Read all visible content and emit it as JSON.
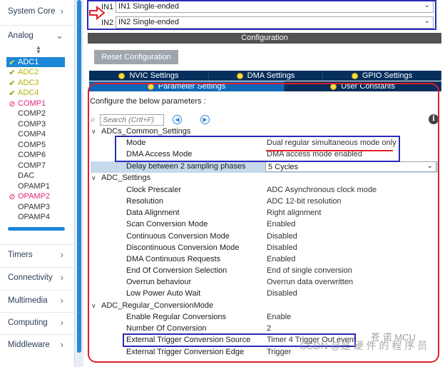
{
  "sidebar": {
    "categories": {
      "system_core": "System Core",
      "analog": "Analog",
      "timers": "Timers",
      "connectivity": "Connectivity",
      "multimedia": "Multimedia",
      "computing": "Computing",
      "middleware": "Middleware"
    },
    "peripherals": [
      {
        "label": "ADC1",
        "status": "selected"
      },
      {
        "label": "ADC2",
        "status": "ok"
      },
      {
        "label": "ADC3",
        "status": "ok"
      },
      {
        "label": "ADC4",
        "status": "ok"
      },
      {
        "label": "COMP1",
        "status": "error"
      },
      {
        "label": "COMP2",
        "status": "none"
      },
      {
        "label": "COMP3",
        "status": "none"
      },
      {
        "label": "COMP4",
        "status": "none"
      },
      {
        "label": "COMP5",
        "status": "none"
      },
      {
        "label": "COMP6",
        "status": "none"
      },
      {
        "label": "COMP7",
        "status": "none"
      },
      {
        "label": "DAC",
        "status": "none"
      },
      {
        "label": "OPAMP1",
        "status": "none"
      },
      {
        "label": "OPAMP2",
        "status": "error"
      },
      {
        "label": "OPAMP3",
        "status": "none"
      },
      {
        "label": "OPAMP4",
        "status": "none"
      }
    ]
  },
  "inputs": {
    "in1_label": "IN1",
    "in1_value": "IN1 Single-ended",
    "in2_label": "IN2",
    "in2_value": "IN2 Single-ended"
  },
  "config_title": "Configuration",
  "reset_button": "Reset Configuration",
  "tabs": {
    "nvic": "NVIC Settings",
    "dma": "DMA Settings",
    "gpio": "GPIO Settings",
    "param": "Parameter Settings",
    "user": "User Constants"
  },
  "configure_text": "Configure the below parameters :",
  "search_placeholder": "Search (Crtl+F)",
  "groups": {
    "common": "ADCs_Common_Settings",
    "settings": "ADC_Settings",
    "regular": "ADC_Regular_ConversionMode"
  },
  "params": {
    "mode": {
      "name": "Mode",
      "value": "Dual regular simultaneous mode only"
    },
    "dma_access": {
      "name": "DMA Access Mode",
      "value": "DMA access mode enabled"
    },
    "delay": {
      "name": "Delay between 2 sampling phases",
      "value": "5 Cycles"
    },
    "clock_prescaler": {
      "name": "Clock Prescaler",
      "value": "ADC Asynchronous clock mode"
    },
    "resolution": {
      "name": "Resolution",
      "value": "ADC 12-bit resolution"
    },
    "data_alignment": {
      "name": "Data Alignment",
      "value": "Right alignment"
    },
    "scan_mode": {
      "name": "Scan Conversion Mode",
      "value": "Enabled"
    },
    "continuous": {
      "name": "Continuous Conversion Mode",
      "value": "Disabled"
    },
    "discontinuous": {
      "name": "Discontinuous Conversion Mode",
      "value": "Disabled"
    },
    "dma_continuous": {
      "name": "DMA Continuous Requests",
      "value": "Enabled"
    },
    "eoc": {
      "name": "End Of Conversion Selection",
      "value": "End of single conversion"
    },
    "overrun": {
      "name": "Overrun behaviour",
      "value": "Overrun data overwritten"
    },
    "low_power": {
      "name": "Low Power Auto Wait",
      "value": "Disabled"
    },
    "enable_regular": {
      "name": "Enable Regular Conversions",
      "value": "Enable"
    },
    "num_conversion": {
      "name": "Number Of Conversion",
      "value": "2"
    },
    "ext_trigger_src": {
      "name": "External Trigger Conversion Source",
      "value": "Timer 4 Trigger Out event"
    },
    "ext_trigger_edge": {
      "name": "External Trigger Conversion Edge",
      "value": "Trigger"
    }
  },
  "watermark": "CSDN @是 硬 件 的 程 序 员",
  "watermark2": "苍 诺 MCU",
  "colors": {
    "tab_dark": "#062f5c",
    "tab_active": "#0f68b7",
    "selected_item": "#1d86d6",
    "annotation_blue": "#2a2ab8",
    "annotation_red": "#e0202a"
  }
}
